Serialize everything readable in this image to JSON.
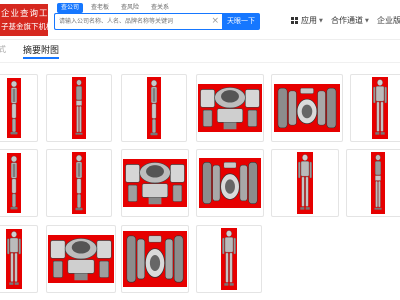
{
  "header": {
    "logo_line1": "企业查询工具",
    "logo_line2": "子基金旗下机构",
    "search_tabs": [
      "查公司",
      "查老板",
      "查风险",
      "查关系"
    ],
    "search_placeholder": "请输入公司名称、人名、品牌名称等关键词",
    "search_button": "天眼一下",
    "nav": [
      {
        "label": "应用",
        "icon": "app-grid-icon"
      },
      {
        "label": "合作通道",
        "icon": "chevron-down-icon"
      },
      {
        "label": "企业版",
        "icon": ""
      }
    ]
  },
  "tabs": {
    "left_fragment": "式",
    "active": "摘要附图"
  },
  "colors": {
    "accent": "#1677ff",
    "brand_red": "#d6281f",
    "figure_bg": "#e60000"
  },
  "thumbnails": [
    {
      "kind": "robot-side"
    },
    {
      "kind": "robot-back"
    },
    {
      "kind": "robot-side"
    },
    {
      "kind": "robot-top"
    },
    {
      "kind": "robot-bottom"
    },
    {
      "kind": "robot-front"
    },
    {
      "kind": "robot-side"
    },
    {
      "kind": "robot-side"
    },
    {
      "kind": "robot-top"
    },
    {
      "kind": "robot-bottom"
    },
    {
      "kind": "robot-front"
    },
    {
      "kind": "robot-back"
    },
    {
      "kind": "robot-front"
    },
    {
      "kind": "robot-top"
    },
    {
      "kind": "robot-bottom"
    },
    {
      "kind": "robot-front"
    }
  ]
}
